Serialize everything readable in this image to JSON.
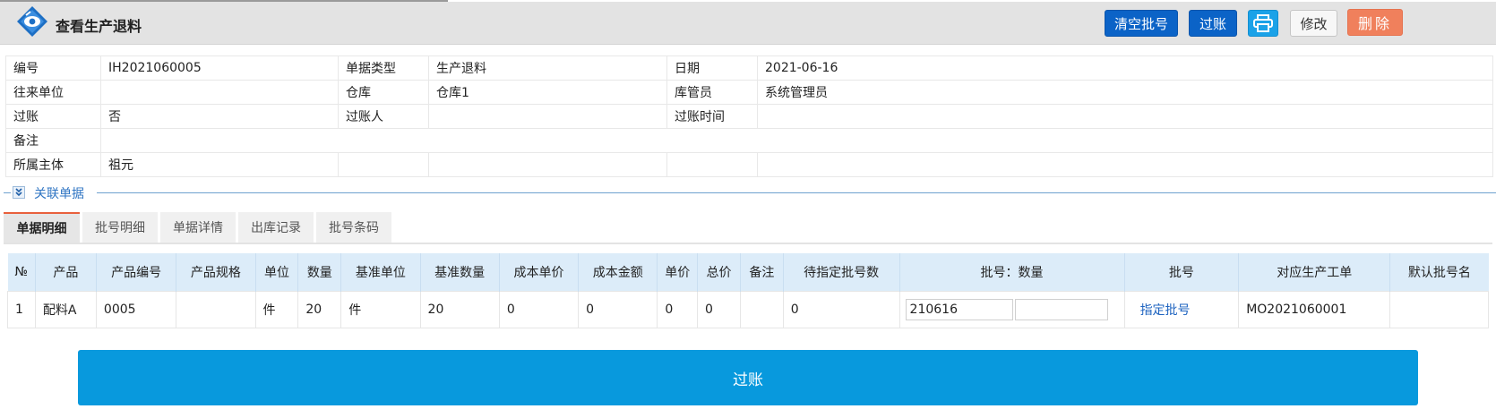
{
  "header": {
    "title": "查看生产退料",
    "buttons": {
      "clear_batch": "清空批号",
      "post": "过账",
      "edit": "修改",
      "delete": "删除"
    }
  },
  "info": {
    "rows": [
      [
        {
          "label": "编号",
          "value": "IH2021060005"
        },
        {
          "label": "单据类型",
          "value": "生产退料"
        },
        {
          "label": "日期",
          "value": "2021-06-16"
        }
      ],
      [
        {
          "label": "往来单位",
          "value": ""
        },
        {
          "label": "仓库",
          "value": "仓库1"
        },
        {
          "label": "库管员",
          "value": "系统管理员"
        }
      ],
      [
        {
          "label": "过账",
          "value": "否"
        },
        {
          "label": "过账人",
          "value": ""
        },
        {
          "label": "过账时间",
          "value": ""
        }
      ],
      [
        {
          "label": "备注",
          "value": ""
        }
      ],
      [
        {
          "label": "所属主体",
          "value": "祖元"
        }
      ]
    ]
  },
  "related": {
    "label": "关联单据"
  },
  "tabs": [
    "单据明细",
    "批号明细",
    "单据详情",
    "出库记录",
    "批号条码"
  ],
  "grid": {
    "columns": [
      "№",
      "产品",
      "产品编号",
      "产品规格",
      "单位",
      "数量",
      "基准单位",
      "基准数量",
      "成本单价",
      "成本金额",
      "单价",
      "总价",
      "备注",
      "待指定批号数",
      "批号：数量",
      "批号",
      "对应生产工单",
      "默认批号名"
    ],
    "rows": [
      {
        "no": "1",
        "product": "配料A",
        "code": "0005",
        "spec": "",
        "unit": "件",
        "qty": "20",
        "base_unit": "件",
        "base_qty": "20",
        "cost_price": "0",
        "cost_amount": "0",
        "price": "0",
        "total": "0",
        "remark": "",
        "pending": "0",
        "batch_input": "210616",
        "batch_qty_input": "",
        "batch_link": "指定批号",
        "work_order": "MO2021060001",
        "default_batch": ""
      }
    ]
  },
  "footer": {
    "post_label": "过账"
  }
}
